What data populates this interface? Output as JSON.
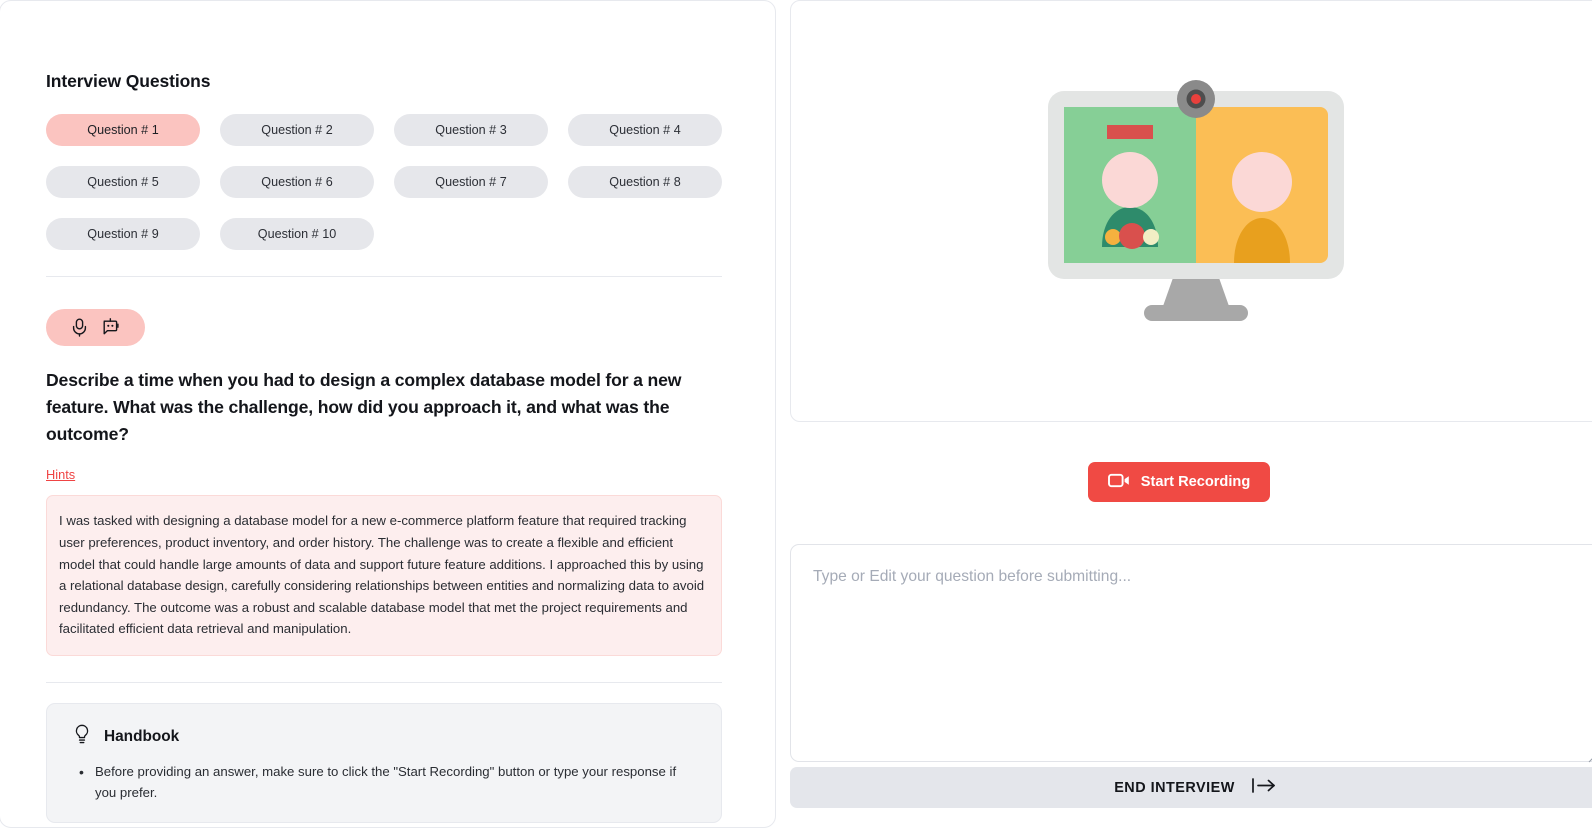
{
  "left_panel": {
    "section_title": "Interview Questions",
    "questions": [
      {
        "label": "Question # 1",
        "active": true
      },
      {
        "label": "Question # 2",
        "active": false
      },
      {
        "label": "Question # 3",
        "active": false
      },
      {
        "label": "Question # 4",
        "active": false
      },
      {
        "label": "Question # 5",
        "active": false
      },
      {
        "label": "Question # 6",
        "active": false
      },
      {
        "label": "Question # 7",
        "active": false
      },
      {
        "label": "Question # 8",
        "active": false
      },
      {
        "label": "Question # 9",
        "active": false
      },
      {
        "label": "Question # 10",
        "active": false
      }
    ],
    "mode_badge": {
      "mic_icon": "microphone-icon",
      "bot_icon": "robot-chat-icon",
      "background_color": "#fbc4c0"
    },
    "current_question": "Describe a time when you had to design a complex database model for a new feature. What was the challenge, how did you approach it, and what was the outcome?",
    "hints_link_label": "Hints",
    "hint_text": "I was tasked with designing a database model for a new e-commerce platform feature that required tracking user preferences, product inventory, and order history. The challenge was to create a flexible and efficient model that could handle large amounts of data and support future feature additions. I approached this by using a relational database design, carefully considering relationships between entities and normalizing data to avoid redundancy. The outcome was a robust and scalable database model that met the project requirements and facilitated efficient data retrieval and manipulation.",
    "handbook": {
      "icon": "lightbulb-icon",
      "title": "Handbook",
      "items": [
        "Before providing an answer, make sure to click the \"Start Recording\" button or type your response if you prefer."
      ]
    }
  },
  "right_panel": {
    "illustration": {
      "name": "video-interview-monitor-illustration",
      "monitor_frame_color": "#e3e5e4",
      "left_screen_color": "#86cf96",
      "right_screen_color": "#fbbe55",
      "left_person_body_color": "#2e8b6b",
      "right_person_body_color": "#e8a01e",
      "face_color": "#fbd8d6",
      "badge_color": "#d9504d",
      "stand_color": "#a8a8a8",
      "webcam_color": "#8a8a8a",
      "webcam_led_color": "#e8403c"
    },
    "record_button": {
      "label": "Start Recording",
      "icon": "video-camera-icon",
      "color": "#f04a44"
    },
    "answer_input": {
      "placeholder": "Type or Edit your question before submitting...",
      "value": ""
    },
    "end_button": {
      "label": "END INTERVIEW",
      "icon": "logout-arrow-icon"
    }
  }
}
